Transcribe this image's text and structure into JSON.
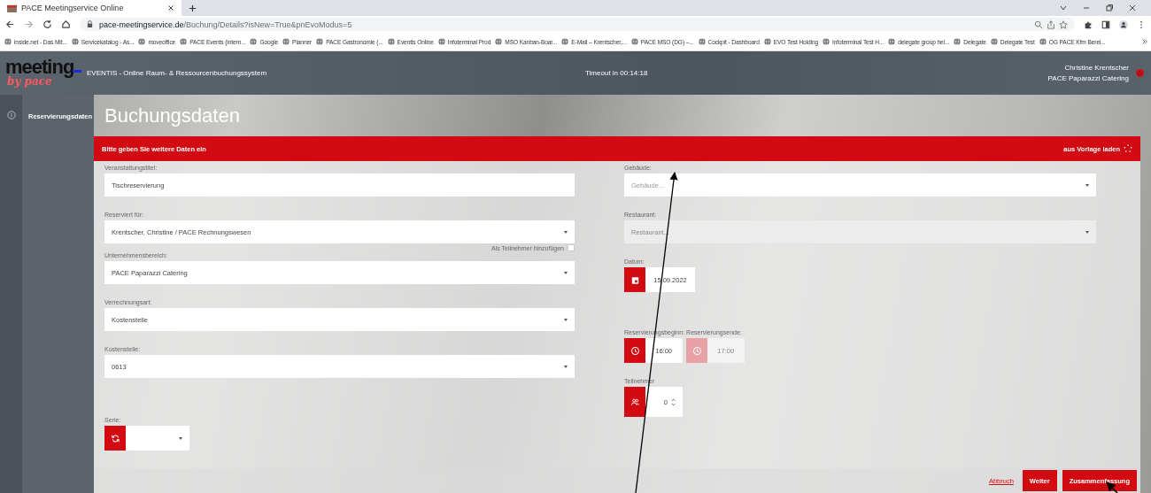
{
  "browser": {
    "tab_title": "PACE Meetingservice Online",
    "url_host": "pace-meetingservice.de",
    "url_path": "/Buchung/Details?isNew=True&pnEvoModus=5",
    "bookmarks": [
      "inside.net - Das Mit...",
      "Servicekatalog - As...",
      "moveoffice",
      "PACE Events (intern...",
      "Google",
      "Planner",
      "PACE Gastronomie (...",
      "Eventis Online",
      "Infoterminal Prod",
      "MSO Kanban-Boar...",
      "E-Mail – Krentscher,...",
      "PACE MSO (DG) –...",
      "Cockpit - Dashboard",
      "EVO Test Holding",
      "Infoterminal Test H...",
      "delegate group hel...",
      "Delegate",
      "Delegate Test",
      "OG PACE Kfm Berei..."
    ]
  },
  "header": {
    "logo": "meeting",
    "logo_script": "by pace",
    "system_title": "EVENTIS - Online Raum- & Ressourcenbuchungssystem",
    "timeout": "Timeout in 00:14:18",
    "user_name": "Christine Krentscher",
    "user_org": "PACE Paparazzi Catering"
  },
  "sidebar": {
    "items": [
      {
        "label": "Reservierungsdaten",
        "selected": true
      }
    ]
  },
  "page_title": "Buchungsdaten",
  "banner": {
    "text": "Bitte geben Sie weitere Daten ein",
    "action": "aus Vorlage laden"
  },
  "left_fields": [
    {
      "label": "Veranstaltungstitel:",
      "value": "Tischreservierung",
      "kind": "text"
    },
    {
      "label": "Reserviert für:",
      "value": "Krentscher, Christine / PACE  Rechnungswesen",
      "kind": "select",
      "checkbox_label": "Als Teilnehmer hinzufügen",
      "checked": false
    },
    {
      "label": "Unternehmensbereich:",
      "value": "PACE Paparazzi Catering",
      "kind": "select"
    },
    {
      "label": "Verrechnungsart:",
      "value": "Kostenstelle",
      "kind": "select"
    },
    {
      "label": "Kostenstelle:",
      "value": "0613",
      "kind": "select"
    }
  ],
  "series": {
    "label": "Serie:"
  },
  "right": {
    "building": {
      "label": "Gebäude:",
      "placeholder": "Gebäude..."
    },
    "restaurant": {
      "label": "Restaurant:",
      "placeholder": "Restaurant...",
      "disabled": true
    },
    "date": {
      "label": "Datum:",
      "value": "15.09.2022"
    },
    "start": {
      "label": "Reservierungsbeginn:",
      "value": "16:00",
      "disabled": false
    },
    "end": {
      "label": "Reservierungsende:",
      "value": "17:00",
      "disabled": true
    },
    "participants": {
      "label": "Teilnehmer",
      "value": "0"
    }
  },
  "footer": {
    "cancel": "Abbruch",
    "next": "Weiter",
    "summary": "Zusammenfassung"
  }
}
